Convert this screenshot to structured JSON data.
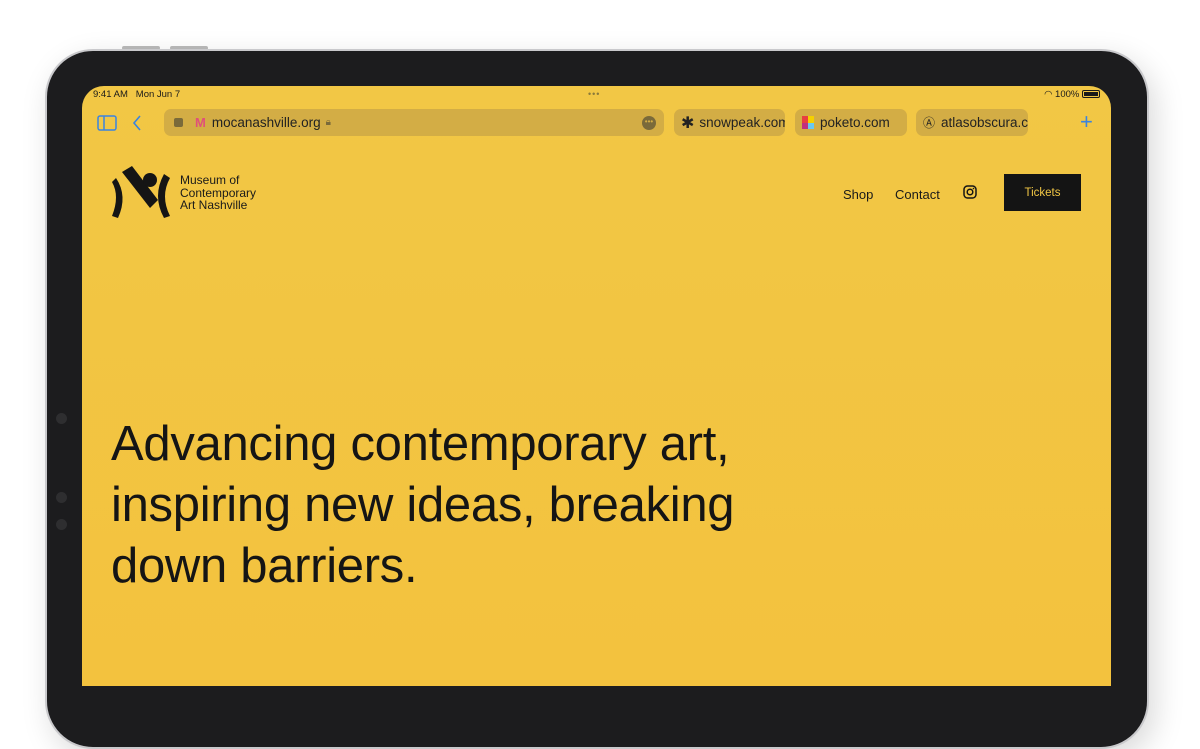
{
  "status": {
    "time": "9:41 AM",
    "date": "Mon Jun 7",
    "battery": "100%"
  },
  "browser": {
    "url": "mocanashville.org",
    "tabs": [
      {
        "label": "snowpeak.com",
        "icon": "asterisk-icon"
      },
      {
        "label": "poketo.com",
        "icon": "color-squares-icon"
      },
      {
        "label": "atlasobscura.c",
        "icon": "atlas-logo-icon"
      }
    ]
  },
  "site": {
    "logo_text": [
      "Museum of",
      "Contemporary",
      "Art Nashville"
    ],
    "nav": {
      "shop": "Shop",
      "contact": "Contact",
      "tickets": "Tickets"
    },
    "hero_lines": [
      "Advancing contemporary art,",
      "inspiring new ideas, breaking",
      "down barriers."
    ]
  },
  "colors": {
    "background": "#f2c745",
    "accent": "#3a84e0",
    "button": "#141414"
  }
}
